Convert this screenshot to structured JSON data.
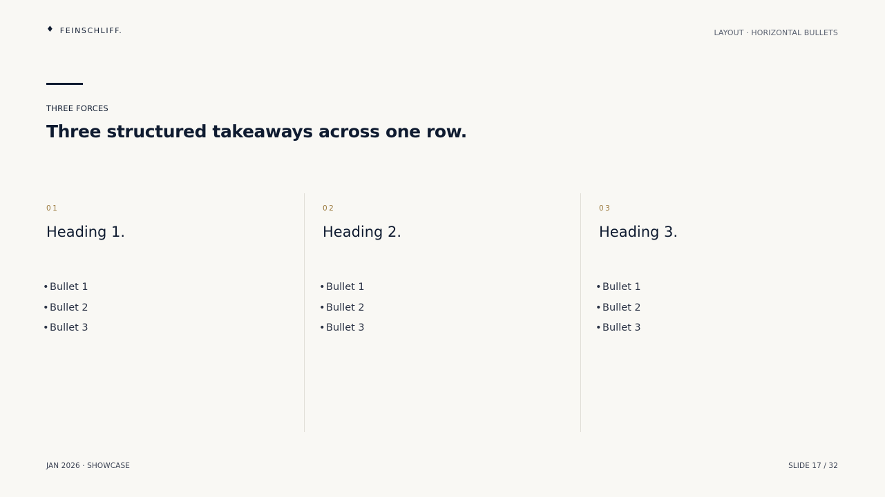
{
  "header": {
    "brand_icon": "diamond-icon",
    "brand_name": "FEINSCHLIFF.",
    "layout_label": "LAYOUT · HORIZONTAL BULLETS"
  },
  "intro": {
    "eyebrow": "THREE FORCES",
    "title": "Three structured takeaways across one row."
  },
  "columns": [
    {
      "number": "01",
      "heading": "Heading 1.",
      "bullets": [
        "Bullet 1",
        "Bullet 2",
        "Bullet 3"
      ]
    },
    {
      "number": "02",
      "heading": "Heading 2.",
      "bullets": [
        "Bullet 1",
        "Bullet 2",
        "Bullet 3"
      ]
    },
    {
      "number": "03",
      "heading": "Heading 3.",
      "bullets": [
        "Bullet 1",
        "Bullet 2",
        "Bullet 3"
      ]
    }
  ],
  "footer": {
    "left": "JAN 2026 · SHOWCASE",
    "right": "SLIDE 17 / 32"
  },
  "colors": {
    "background": "#f9f8f4",
    "ink": "#0f1b30",
    "accent_gold": "#9b7a3e",
    "divider": "#e0ddd6"
  }
}
